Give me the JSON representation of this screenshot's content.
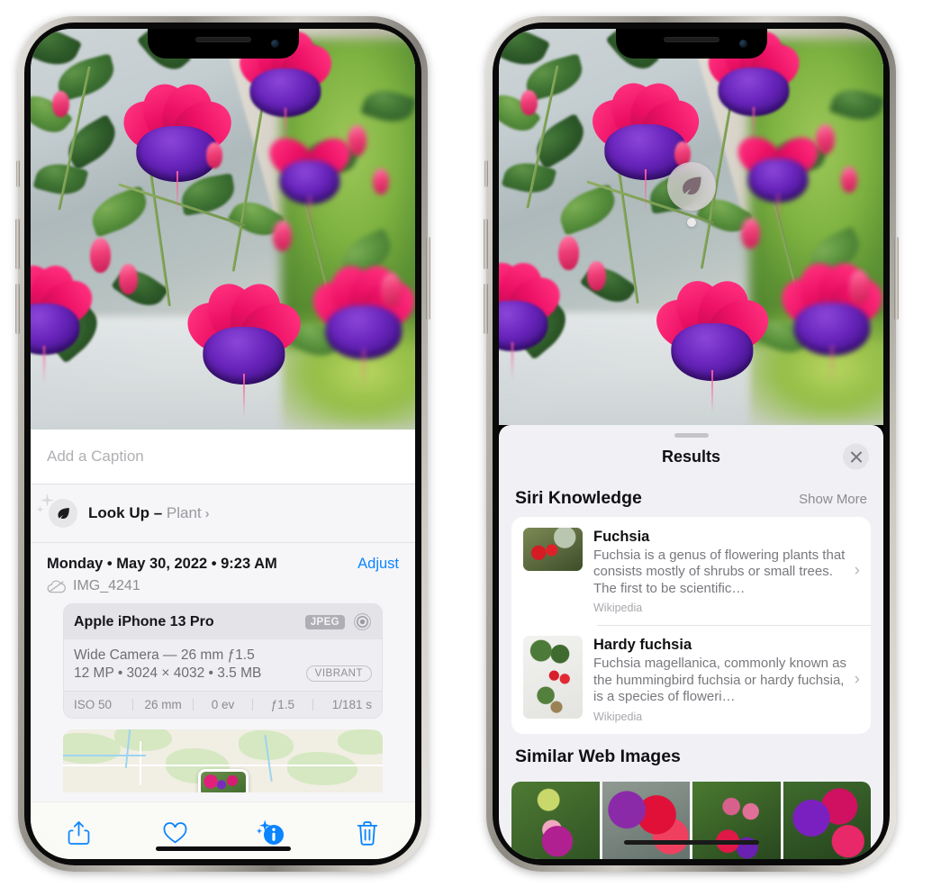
{
  "left_phone": {
    "caption_placeholder": "Add a Caption",
    "lookup": {
      "label": "Look Up – ",
      "subject": "Plant",
      "chevron": "›",
      "icon": "leaf-icon"
    },
    "meta": {
      "date": "Monday • May 30, 2022 • 9:23 AM",
      "adjust_label": "Adjust",
      "filename": "IMG_4241",
      "cloud_icon": "icloud-slash-icon"
    },
    "exif": {
      "device": "Apple iPhone 13 Pro",
      "format_badge": "JPEG",
      "aperture_icon": "aperture-icon",
      "lens_line": "Wide Camera — 26 mm ƒ1.5",
      "size_line": "12 MP • 3024 × 4032 • 3.5 MB",
      "style_badge": "VIBRANT",
      "stats": [
        "ISO 50",
        "26 mm",
        "0 ev",
        "ƒ1.5",
        "1/181 s"
      ]
    },
    "toolbar": [
      {
        "name": "share-button",
        "icon": "share-icon"
      },
      {
        "name": "favorite-button",
        "icon": "heart-icon"
      },
      {
        "name": "info-button",
        "icon": "info-sparkle-icon"
      },
      {
        "name": "delete-button",
        "icon": "trash-icon"
      }
    ]
  },
  "right_phone": {
    "visual_lookup_badge": "leaf-icon",
    "sheet": {
      "title": "Results",
      "close_icon": "close-icon",
      "siri_knowledge": {
        "title": "Siri Knowledge",
        "show_more": "Show More",
        "cards": [
          {
            "title": "Fuchsia",
            "description": "Fuchsia is a genus of flowering plants that consists mostly of shrubs or small trees. The first to be scientific…",
            "source": "Wikipedia",
            "chevron": "›"
          },
          {
            "title": "Hardy fuchsia",
            "description": "Fuchsia magellanica, commonly known as the hummingbird fuchsia or hardy fuchsia, is a species of floweri…",
            "source": "Wikipedia",
            "chevron": "›"
          }
        ]
      },
      "similar_web_images": {
        "title": "Similar Web Images",
        "count": 4
      }
    }
  },
  "colors": {
    "accent_blue": "#0a84ff",
    "sheet_bg": "#f1f1f5",
    "card_bg": "#ffffff",
    "secondary_text": "#8e8e93"
  }
}
